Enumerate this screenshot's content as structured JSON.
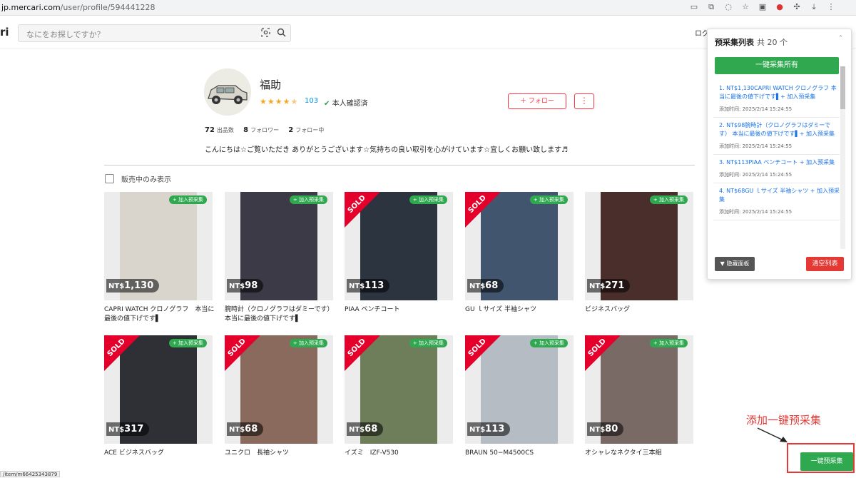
{
  "browser": {
    "url_domain": "jp.mercari.com",
    "url_path": "/user/profile/594441228"
  },
  "header": {
    "logo": "ri",
    "search_placeholder": "なにをお探しですか？",
    "login_label": "ログ"
  },
  "profile": {
    "name": "福助",
    "rating_stars": 4.5,
    "rating_count": "103",
    "verified_label": "本人確認済",
    "follow_label": "＋ フォロー",
    "more_label": "⋮",
    "stats": [
      {
        "num": "72",
        "label": "出品数"
      },
      {
        "num": "8",
        "label": "フォロワー"
      },
      {
        "num": "2",
        "label": "フォロー中"
      }
    ],
    "bio": "こんにちは☆ご覧いただき ありがとうございます☆気持ちの良い取引を心がけています☆宜しくお願い致します♬"
  },
  "filter": {
    "on_sale_label": "販売中のみ表示"
  },
  "items": [
    {
      "title": "CAPRI WATCH クロノグラフ　本当に最後の値下げです▌",
      "price_prefix": "NT$",
      "price": "1,130",
      "sold": false,
      "add_label": "+ 加入预采集",
      "thumb_color": "#d9d4cc"
    },
    {
      "title": "腕時計（クロノグラフはダミーです）本当に最後の値下げです▌",
      "price_prefix": "NT$",
      "price": "98",
      "sold": false,
      "add_label": "+ 加入预采集",
      "thumb_color": "#3d3a48"
    },
    {
      "title": "PIAA ベンチコート",
      "price_prefix": "NT$",
      "price": "113",
      "sold": true,
      "sold_label": "SOLD",
      "add_label": "+ 加入预采集",
      "thumb_color": "#2c3440"
    },
    {
      "title": "GU ｌサイズ 半袖シャツ",
      "price_prefix": "NT$",
      "price": "68",
      "sold": true,
      "sold_label": "SOLD",
      "add_label": "+ 加入预采集",
      "thumb_color": "#41566e"
    },
    {
      "title": "ビジネスバッグ",
      "price_prefix": "NT$",
      "price": "271",
      "sold": false,
      "add_label": "+ 加入预采集",
      "thumb_color": "#4a2e2c"
    },
    {
      "title": "ACE ビジネスバッグ",
      "price_prefix": "NT$",
      "price": "317",
      "sold": true,
      "sold_label": "SOLD",
      "add_label": "+ 加入预采集",
      "thumb_color": "#2e3035"
    },
    {
      "title": "ユニクロ　長袖シャツ",
      "price_prefix": "NT$",
      "price": "68",
      "sold": true,
      "sold_label": "SOLD",
      "add_label": "+ 加入预采集",
      "thumb_color": "#8a6a5c"
    },
    {
      "title": "イズミ　IZF-V530",
      "price_prefix": "NT$",
      "price": "68",
      "sold": true,
      "sold_label": "SOLD",
      "add_label": "+ 加入预采集",
      "thumb_color": "#6e7d5a"
    },
    {
      "title": "BRAUN 50−M4500CS",
      "price_prefix": "NT$",
      "price": "113",
      "sold": true,
      "sold_label": "SOLD",
      "add_label": "+ 加入预采集",
      "thumb_color": "#b6bcc4"
    },
    {
      "title": "オシャレなネクタイ三本組",
      "price_prefix": "NT$",
      "price": "80",
      "sold": true,
      "sold_label": "SOLD",
      "add_label": "+ 加入预采集",
      "thumb_color": "#7a6a66"
    }
  ],
  "panel": {
    "title": "预采集列表",
    "count": "共 20 个",
    "caret": "˄",
    "collect_all_label": "一键采集所有",
    "entries": [
      {
        "text": "1. NT$1,130CAPRI WATCH クロノグラフ 本当に最後の値下げです▌+ 加入预采集",
        "time": "添加时间: 2025/2/14 15:24:55"
      },
      {
        "text": "2. NT$98腕時計（クロノグラフはダミーです） 本当に最後の値下げです▌+ 加入预采集",
        "time": "添加时间: 2025/2/14 15:24:55"
      },
      {
        "text": "3. NT$113PIAA ベンチコート + 加入预采集",
        "time": "添加时间: 2025/2/14 15:24:55"
      },
      {
        "text": "4. NT$68GU ｌサイズ 半袖シャツ + 加入预采集",
        "time": "添加时间: 2025/2/14 15:24:55"
      }
    ],
    "hide_label": "▼ 隐藏面板",
    "clear_label": "清空列表"
  },
  "annotation": {
    "text": "添加一键预采集",
    "color": "#e53935"
  },
  "one_key_label": "一键预采集",
  "status_url": "/item/m66425343879"
}
